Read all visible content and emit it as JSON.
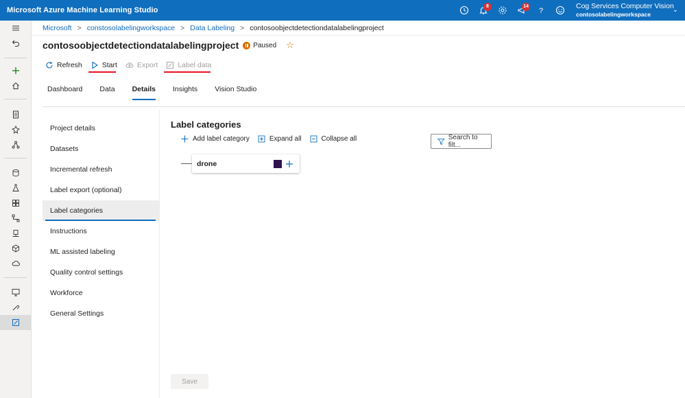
{
  "header": {
    "app_title": "Microsoft Azure Machine Learning Studio",
    "notifications_count": "8",
    "feedback_count": "14",
    "account_name": "Cog Services Computer Vision",
    "workspace_name": "contosolabelingworkspace"
  },
  "breadcrumb": {
    "items": [
      "Microsoft",
      "constosolabelingworkspace",
      "Data Labeling"
    ],
    "current": "contosoobjectdetectiondatalabelingproject"
  },
  "project": {
    "title": "contosoobjectdetectiondatalabelingproject",
    "status": "Paused"
  },
  "toolbar": {
    "refresh": "Refresh",
    "start": "Start",
    "export": "Export",
    "label_data": "Label data"
  },
  "tabs": [
    "Dashboard",
    "Data",
    "Details",
    "Insights",
    "Vision Studio"
  ],
  "active_tab": "Details",
  "settings_nav": [
    "Project details",
    "Datasets",
    "Incremental refresh",
    "Label export (optional)",
    "Label categories",
    "Instructions",
    "ML assisted labeling",
    "Quality control settings",
    "Workforce",
    "General Settings"
  ],
  "active_settings_item": "Label categories",
  "content": {
    "section_title": "Label categories",
    "add_label": "Add label category",
    "expand_all": "Expand all",
    "collapse_all": "Collapse all",
    "search_placeholder": "Search to filt...",
    "categories": [
      {
        "name": "drone",
        "color": "#2f124f"
      }
    ],
    "save": "Save"
  },
  "colors": {
    "header_bg": "#106ebe",
    "accent": "#0f6cbd",
    "highlight_underline": "#e81123",
    "status": "#d86f00"
  }
}
